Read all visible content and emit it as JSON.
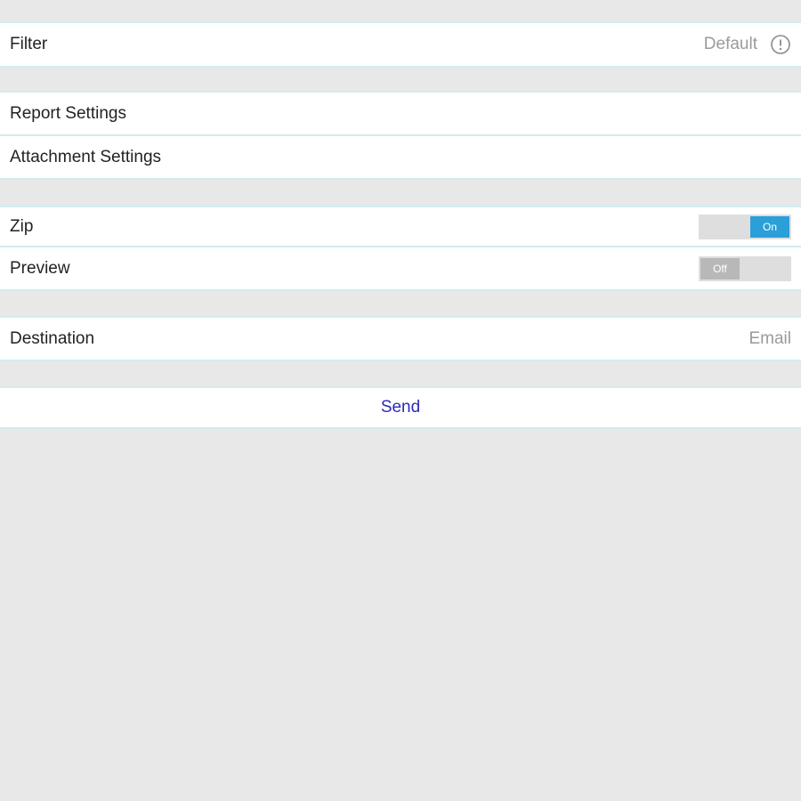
{
  "filter": {
    "label": "Filter",
    "value": "Default",
    "icon": "info-icon"
  },
  "settings": {
    "report_label": "Report Settings",
    "attachment_label": "Attachment Settings"
  },
  "toggles": {
    "zip": {
      "label": "Zip",
      "state_text": "On",
      "on": true
    },
    "preview": {
      "label": "Preview",
      "state_text": "Off",
      "on": false
    }
  },
  "destination": {
    "label": "Destination",
    "value": "Email"
  },
  "send": {
    "label": "Send"
  },
  "colors": {
    "background": "#e8e8e8",
    "divider": "#d3ecec",
    "toggle_on": "#2a9fd8",
    "toggle_off_knob": "#b8b8b8",
    "send_text": "#2b2bb5"
  }
}
